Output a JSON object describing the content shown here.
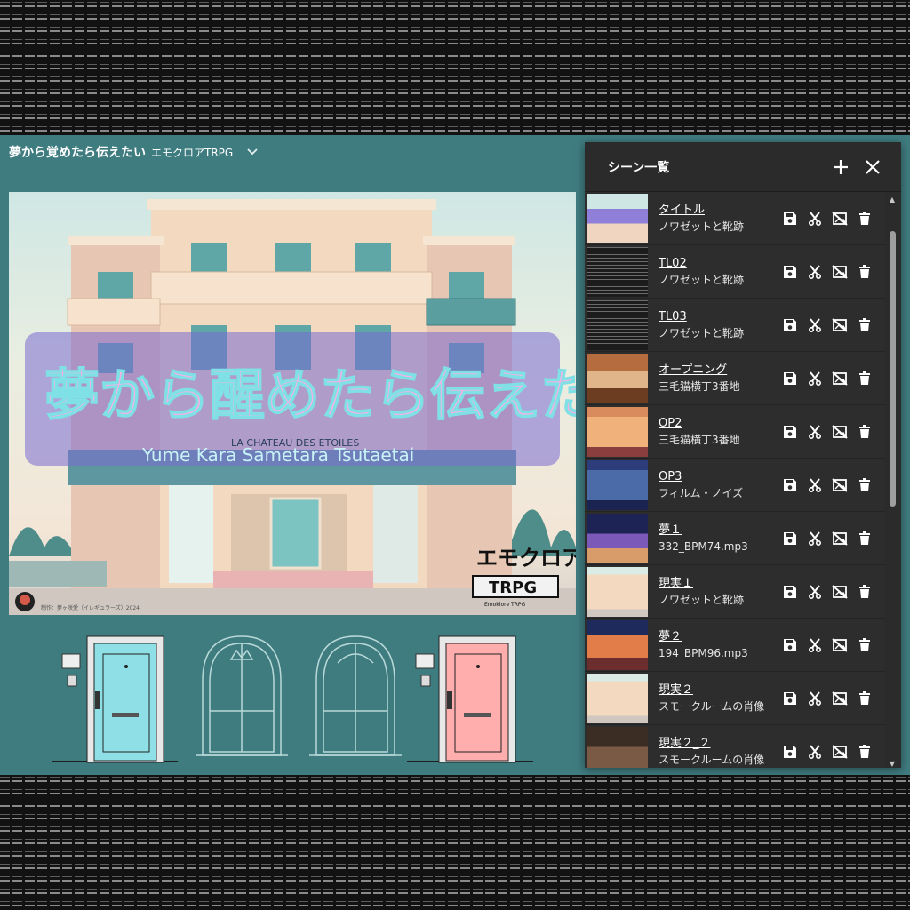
{
  "room": {
    "title": "夢から覚めたら伝えたい",
    "system": "エモクロアTRPG"
  },
  "scene_image": {
    "logo_title": "夢から醒めたら伝えたい",
    "logo_subtitle": "Yume Kara Sametara Tsutaetai",
    "building_sign": "LA CHATEAU DES ETOILES",
    "brand_top": "エモクロア",
    "brand_bottom": "TRPG",
    "brand_caption": "Emoklore TRPG",
    "credit": "制作：夢ヶ咲愛（イレギュラーズ）2024"
  },
  "scene_panel": {
    "title": "シーン一覧",
    "add_icon": "plus-icon",
    "close_icon": "close-icon",
    "scenes": [
      {
        "name": "タイトル",
        "bgm": "ノワゼットと靴跡",
        "thumb": "title"
      },
      {
        "name": "TL02",
        "bgm": "ノワゼットと靴跡",
        "thumb": "dark-text"
      },
      {
        "name": "TL03",
        "bgm": "ノワゼットと靴跡",
        "thumb": "dark-text"
      },
      {
        "name": "オープニング",
        "bgm": "三毛猫横丁3番地",
        "thumb": "room"
      },
      {
        "name": "OP2",
        "bgm": "三毛猫横丁3番地",
        "thumb": "warm-building"
      },
      {
        "name": "OP3",
        "bgm": "フィルム・ノイズ",
        "thumb": "blue-building"
      },
      {
        "name": "夢１",
        "bgm": "332_BPM74.mp3",
        "thumb": "purple-night"
      },
      {
        "name": "現実１",
        "bgm": "ノワゼットと靴跡",
        "thumb": "building"
      },
      {
        "name": "夢２",
        "bgm": "194_BPM96.mp3",
        "thumb": "orange-shrine"
      },
      {
        "name": "現実２",
        "bgm": "スモークルームの肖像",
        "thumb": "building"
      },
      {
        "name": "現実２_２",
        "bgm": "スモークルームの肖像",
        "thumb": "brown-room"
      }
    ]
  },
  "colors": {
    "stage": "#3f7c80",
    "panel": "#2b2b2b",
    "door_blue": "#8fe0e6",
    "door_pink": "#ffadad"
  }
}
